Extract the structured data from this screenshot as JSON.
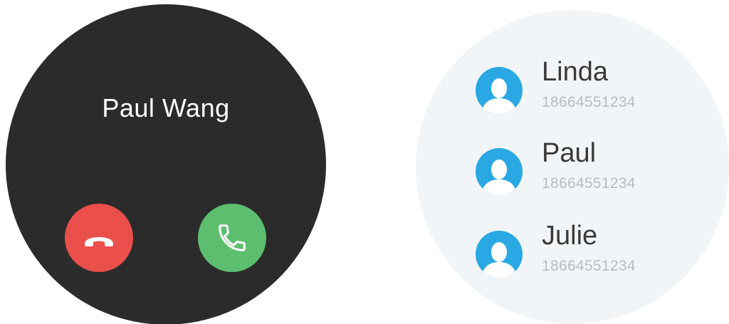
{
  "incoming_call": {
    "caller_name": "Paul Wang",
    "decline_icon": "phone-hangup-icon",
    "answer_icon": "phone-icon",
    "colors": {
      "background": "#2b2b2b",
      "decline": "#ea4f4b",
      "answer": "#5dbe6f"
    }
  },
  "contacts": {
    "items": [
      {
        "name": "Linda",
        "number": "18664551234",
        "icon": "avatar-icon"
      },
      {
        "name": "Paul",
        "number": "18664551234",
        "icon": "avatar-icon"
      },
      {
        "name": "Julie",
        "number": "18664551234",
        "icon": "avatar-icon"
      }
    ],
    "colors": {
      "background": "#f1f5f7",
      "avatar": "#29a8e3",
      "name": "#3a3a3a",
      "number": "#b7bdc0"
    }
  }
}
